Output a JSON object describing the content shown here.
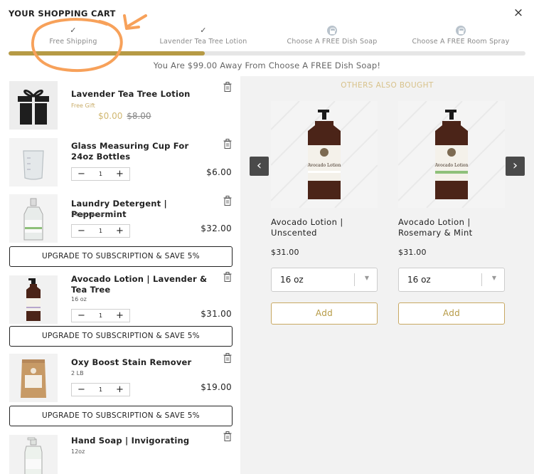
{
  "header": {
    "title": "YOUR SHOPPING CART",
    "close_symbol": "×"
  },
  "steps": [
    {
      "label": "Free Shipping",
      "status": "done",
      "icon": "check-icon"
    },
    {
      "label": "Lavender Tea Tree Lotion",
      "status": "done",
      "icon": "check-icon"
    },
    {
      "label": "Choose A FREE Dish Soap",
      "status": "locked",
      "icon": "lock-icon"
    },
    {
      "label": "Choose A FREE Room Spray",
      "status": "locked",
      "icon": "lock-icon"
    }
  ],
  "progress": {
    "fraction": 0.38,
    "color": "#b69a45"
  },
  "away_message": "You Are $99.00 Away From Choose A FREE Dish Soap!",
  "cart": {
    "items": [
      {
        "name": "Lavender Tea Tree Lotion",
        "sub": "Free Gift",
        "price_now": "$0.00",
        "price_was": "$8.00"
      },
      {
        "name": "Glass Measuring Cup For 24oz Bottles",
        "qty": "1",
        "price": "$6.00"
      },
      {
        "name": "Laundry Detergent | Peppermint",
        "sub": "24 oz Glass",
        "qty": "1",
        "price": "$32.00"
      },
      {
        "name": "Avocado Lotion | Lavender & Tea Tree",
        "sub": "16 oz",
        "qty": "1",
        "price": "$31.00"
      },
      {
        "name": "Oxy Boost Stain Remover",
        "sub": "2 LB",
        "qty": "1",
        "price": "$19.00"
      },
      {
        "name": "Hand Soap | Invigorating",
        "sub": "12oz"
      }
    ],
    "subscription_label": "UPGRADE TO SUBSCRIPTION & SAVE 5%",
    "minus": "−",
    "plus": "+"
  },
  "recommendations": {
    "title": "OTHERS ALSO BOUGHT",
    "prev": "‹",
    "next": "›",
    "products": [
      {
        "name": "Avocado Lotion | Unscented",
        "price": "$31.00",
        "size": "16 oz",
        "add_label": "Add",
        "bottle_label": "Avocado Lotion",
        "label_color": "#ffffff"
      },
      {
        "name": "Avocado Lotion | Rosemary & Mint",
        "price": "$31.00",
        "size": "16 oz",
        "add_label": "Add",
        "bottle_label": "Avocado Lotion",
        "label_color": "#8ec07a"
      }
    ]
  },
  "colors": {
    "gold": "#b69a45",
    "light_gold": "#d1b872",
    "annotation": "#f7a15a"
  }
}
